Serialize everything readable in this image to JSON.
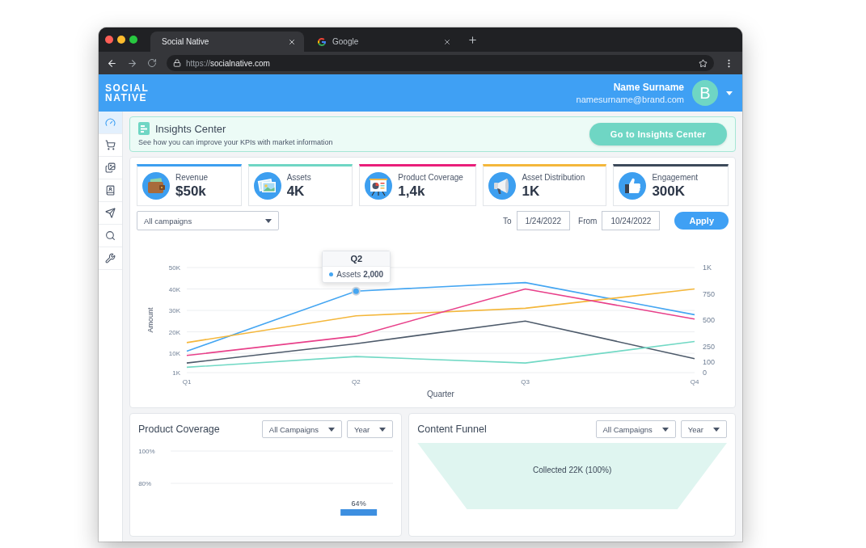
{
  "browser": {
    "tabs": [
      {
        "kind": "plain",
        "title": "Social Native",
        "selected": true
      },
      {
        "kind": "google",
        "title": "Google",
        "selected": false
      }
    ],
    "address": {
      "scheme": "https://",
      "host": "socialnative.com"
    }
  },
  "header": {
    "logo": [
      "SOCIAL",
      "NATIVE"
    ],
    "user": {
      "name": "Name Surname",
      "email": "namesurname@brand.com",
      "initial": "B"
    }
  },
  "sidebar": {
    "items": [
      {
        "kind": "gauge",
        "selected": true
      },
      {
        "kind": "cart",
        "selected": false
      },
      {
        "kind": "images",
        "selected": false
      },
      {
        "kind": "contacts",
        "selected": false
      },
      {
        "kind": "send",
        "selected": false
      },
      {
        "kind": "search",
        "selected": false
      },
      {
        "kind": "wrench",
        "selected": false
      }
    ]
  },
  "banner": {
    "title": "Insights Center",
    "subtitle": "See how you can improve your KPIs with market information",
    "button": "Go to Insights Center"
  },
  "kpis": [
    {
      "kind": "wallet",
      "label": "Revenue",
      "value": "$50k",
      "color": "#3d9ff0"
    },
    {
      "kind": "photos",
      "label": "Assets",
      "value": "4K",
      "color": "#6fd6c4"
    },
    {
      "kind": "easel",
      "label": "Product Coverage",
      "value": "1,4k",
      "color": "#e91e7a"
    },
    {
      "kind": "megaphone",
      "label": "Asset Distribution",
      "value": "1K",
      "color": "#f4b73b"
    },
    {
      "kind": "thumbs_up",
      "label": "Engagement",
      "value": "300K",
      "color": "#3d4a5a"
    }
  ],
  "filters": {
    "campaign": "All campaigns",
    "to_label": "To",
    "to_date": "1/24/2022",
    "from_label": "From",
    "from_date": "10/24/2022",
    "apply": "Apply"
  },
  "main_chart": {
    "tooltip": {
      "title": "Q2"
    },
    "chart_data": {
      "type": "line",
      "xlabel": "Quarter",
      "ylabel": "Amount",
      "categories": [
        "Q1",
        "Q2",
        "Q3",
        "Q4"
      ],
      "ylim": [
        1000,
        50000
      ],
      "yticks": [
        {
          "value": 1000,
          "label": "1K"
        },
        {
          "value": 10000,
          "label": "10K"
        },
        {
          "value": 20000,
          "label": "20K"
        },
        {
          "value": 30000,
          "label": "30K"
        },
        {
          "value": 40000,
          "label": "40K"
        },
        {
          "value": 50000,
          "label": "50K"
        }
      ],
      "y2lim": [
        0,
        1000
      ],
      "y2ticks": [
        0,
        100,
        250,
        500,
        750,
        {
          "value": 1000,
          "label": "1K"
        }
      ],
      "grid": true,
      "series": [
        {
          "color": "#45a6f2",
          "values": [
            11000,
            39000,
            43000,
            28000
          ]
        },
        {
          "color": "#f4b73b",
          "values": [
            15000,
            27500,
            31000,
            40000
          ]
        },
        {
          "color": "#e8408a",
          "values": [
            9000,
            18000,
            40000,
            26000
          ]
        },
        {
          "color": "#4d5a6a",
          "values": [
            5500,
            14500,
            25000,
            7500
          ]
        },
        {
          "color": "#72d9c5",
          "values": [
            3500,
            8500,
            5500,
            15500
          ]
        }
      ],
      "annotations": [
        {
          "x": "Q2",
          "y": 39000,
          "text": "Assets **2,000**"
        }
      ]
    }
  },
  "product_coverage": {
    "title": "Product Coverage",
    "filters": [
      "All Campaigns",
      "Year"
    ],
    "chart_data": {
      "type": "bar",
      "ylim": [
        60,
        100
      ],
      "yticks": [
        {
          "value": 80,
          "label": "80%"
        },
        {
          "value": 100,
          "label": "100%"
        }
      ],
      "grid": true,
      "values": [
        64
      ],
      "value_labels": [
        "64%"
      ]
    }
  },
  "content_funnel": {
    "title": "Content Funnel",
    "filters": [
      "All Campaigns",
      "Year"
    ],
    "stages": [
      {
        "label": "Collected 22K (100%)"
      }
    ]
  }
}
